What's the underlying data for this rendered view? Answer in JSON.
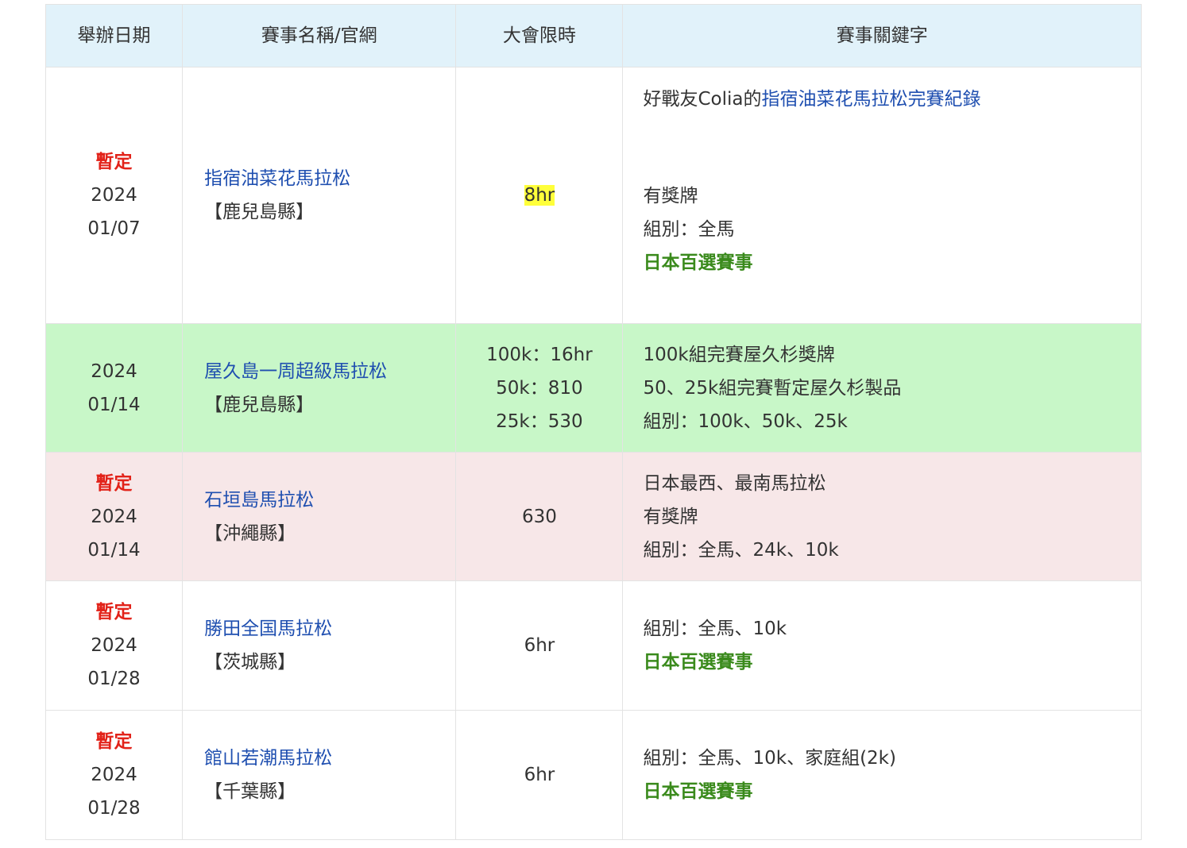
{
  "header": {
    "date": "舉辦日期",
    "name": "賽事名稱/官網",
    "limit": "大會限時",
    "keywords": "賽事關鍵字"
  },
  "rows": [
    {
      "tentative": "暫定",
      "year": "2024",
      "date": "01/07",
      "race_name": "指宿油菜花馬拉松",
      "prefecture": "【鹿兒島縣】",
      "limit": "8hr",
      "kw_prefix": "好戰友Colia的",
      "kw_link": "指宿油菜花馬拉松完賽紀錄",
      "medal": "有獎牌",
      "divisions": "組別：全馬",
      "badge": "日本百選賽事"
    },
    {
      "year": "2024",
      "date": "01/14",
      "race_name": "屋久島一周超級馬拉松",
      "prefecture": "【鹿兒島縣】",
      "limits": [
        "100k：16hr",
        "50k：810",
        "25k：530"
      ],
      "keywords": [
        "100k組完賽屋久杉獎牌",
        "50、25k組完賽暫定屋久杉製品",
        "組別：100k、50k、25k"
      ]
    },
    {
      "tentative": "暫定",
      "year": "2024",
      "date": "01/14",
      "race_name": "石垣島馬拉松",
      "prefecture": "【沖繩縣】",
      "limit": "630",
      "keywords": [
        "日本最西、最南馬拉松",
        "有獎牌",
        "組別：全馬、24k、10k"
      ]
    },
    {
      "tentative": "暫定",
      "year": "2024",
      "date": "01/28",
      "race_name": "勝田全国馬拉松",
      "prefecture": "【茨城縣】",
      "limit": "6hr",
      "divisions": "組別：全馬、10k",
      "badge": "日本百選賽事"
    },
    {
      "tentative": "暫定",
      "year": "2024",
      "date": "01/28",
      "race_name": "館山若潮馬拉松",
      "prefecture": "【千葉縣】",
      "limit": "6hr",
      "divisions": "組別：全馬、10k、家庭組(2k)",
      "badge": "日本百選賽事"
    }
  ],
  "colors": {
    "header_bg": "#e1f2fa",
    "row_green": "#c8f7c8",
    "row_pink": "#f7e7e8",
    "tentative": "#e2231a",
    "link": "#1f4fb0",
    "badge": "#3a8a1c",
    "highlight": "#ffff3a"
  }
}
